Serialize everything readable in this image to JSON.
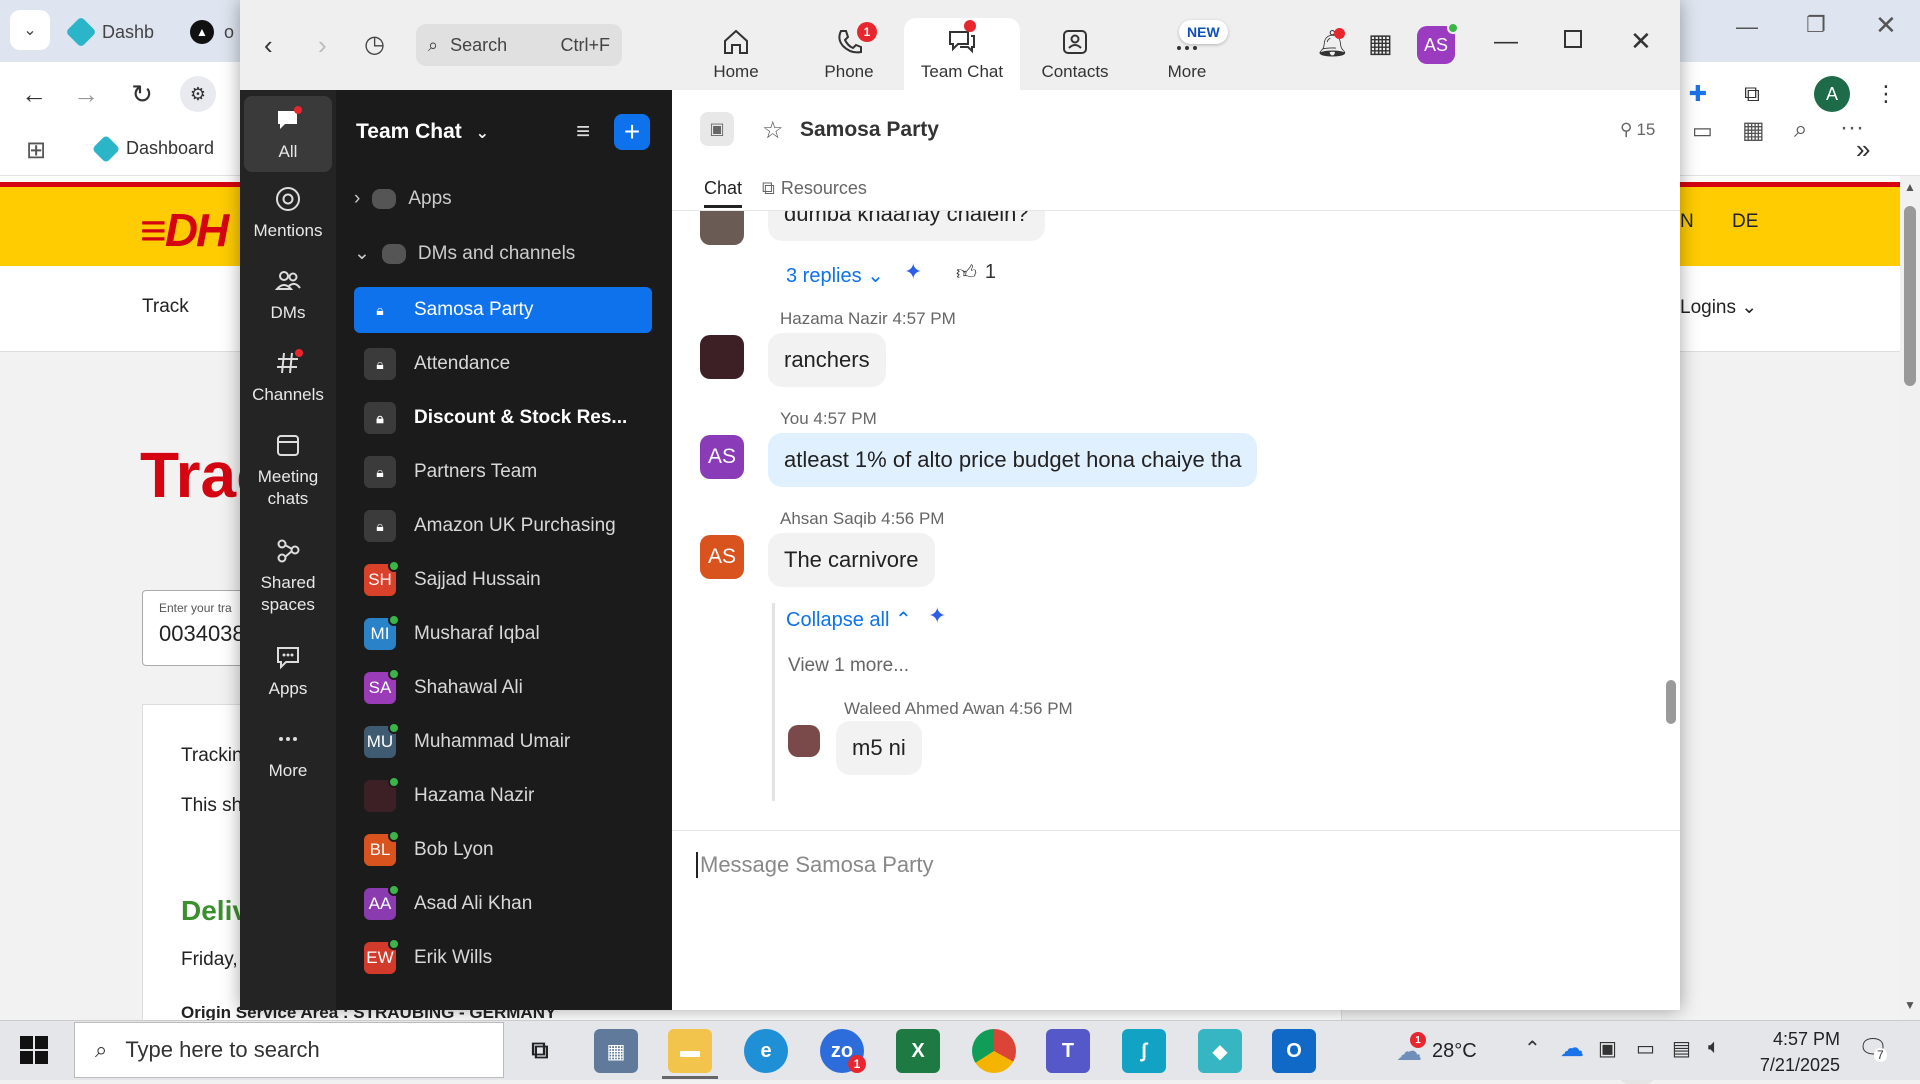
{
  "chrome": {
    "tabs": [
      {
        "label": "Dashb"
      },
      {
        "label": "o"
      }
    ],
    "bookmark_dashboard": "Dashboard",
    "account_initial": "A"
  },
  "dhl": {
    "nav_track": "Track",
    "nav_logins": "Logins",
    "lang_en": "N",
    "lang_de": "DE",
    "heading": "Trac",
    "input_label": "Enter your tra",
    "input_value": "0034038",
    "tracking_label": "Trackin",
    "shipment_text": "This shi",
    "delivered": "Deliv",
    "date_text": "Friday,",
    "origin": "Origin Service Area : STRAUBING - GERMANY"
  },
  "zoom": {
    "search_placeholder": "Search",
    "search_shortcut": "Ctrl+F",
    "nav": [
      {
        "label": "Home"
      },
      {
        "label": "Phone",
        "badge": "1"
      },
      {
        "label": "Team Chat"
      },
      {
        "label": "Contacts"
      },
      {
        "label": "More",
        "badge": "NEW"
      }
    ],
    "user_initials": "AS",
    "rail": [
      {
        "label": "All"
      },
      {
        "label": "Mentions"
      },
      {
        "label": "DMs"
      },
      {
        "label": "Channels"
      },
      {
        "label": "Meeting chats"
      },
      {
        "label": "Shared spaces"
      },
      {
        "label": "Apps"
      },
      {
        "label": "More"
      }
    ],
    "sidebar": {
      "title": "Team Chat",
      "section_apps": "Apps",
      "section_dms": "DMs and channels",
      "channels": [
        {
          "label": "Samosa Party",
          "type": "lock"
        },
        {
          "label": "Attendance",
          "type": "lock"
        },
        {
          "label": "Discount & Stock Res...",
          "type": "lock"
        },
        {
          "label": "Partners Team",
          "type": "lock"
        },
        {
          "label": "Amazon UK Purchasing",
          "type": "lock"
        },
        {
          "label": "Sajjad Hussain",
          "type": "person",
          "initials": "SH",
          "color": "#d9412b"
        },
        {
          "label": "Musharaf Iqbal",
          "type": "person",
          "initials": "MI",
          "color": "#2a82c8"
        },
        {
          "label": "Shahawal Ali",
          "type": "person",
          "initials": "SA",
          "color": "#9a3bb8"
        },
        {
          "label": "Muhammad Umair",
          "type": "person",
          "initials": "MU",
          "color": "#3f5b72"
        },
        {
          "label": "Hazama Nazir",
          "type": "person",
          "initials": "",
          "color": "#3d2026"
        },
        {
          "label": "Bob Lyon",
          "type": "person",
          "initials": "BL",
          "color": "#d9531e"
        },
        {
          "label": "Asad Ali Khan",
          "type": "person",
          "initials": "AA",
          "color": "#8a3bb0"
        },
        {
          "label": "Erik Wills",
          "type": "person",
          "initials": "EW",
          "color": "#d23b2c"
        }
      ]
    },
    "chat": {
      "title": "Samosa Party",
      "member_count": "15",
      "tab_chat": "Chat",
      "tab_resources": "Resources",
      "first_msg": "dumba khaanay chalein?",
      "replies": "3 replies",
      "reaction_count": "1",
      "messages": [
        {
          "name": "Hazama Nazir",
          "time": "4:57 PM",
          "text": "ranchers"
        },
        {
          "name": "You",
          "time": "4:57 PM",
          "text": "atleast 1% of alto price budget hona chaiye tha",
          "initials": "AS"
        },
        {
          "name": "Ahsan Saqib",
          "time": "4:56 PM",
          "text": "The carnivore",
          "initials": "AS"
        }
      ],
      "collapse_all": "Collapse all",
      "view_more": "View 1 more...",
      "thread_reply": {
        "name": "Waleed Ahmed Awan",
        "time": "4:56 PM",
        "text": "m5 ni"
      },
      "composer_placeholder": "Message Samosa Party"
    }
  },
  "taskbar": {
    "search_placeholder": "Type here to search",
    "weather": "28°C",
    "time": "4:57 PM",
    "date": "7/21/2025",
    "notification_count": "7",
    "zoom_badge": "1",
    "weather_badge": "1"
  }
}
